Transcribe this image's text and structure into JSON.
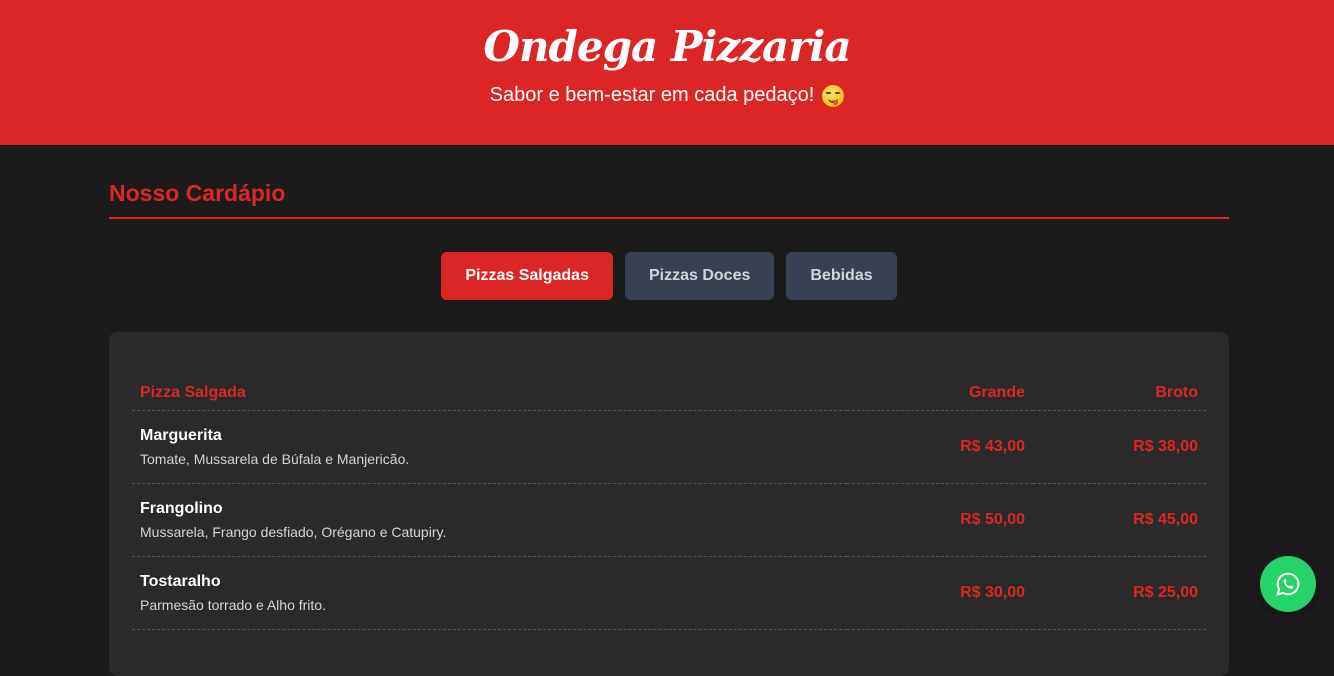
{
  "header": {
    "brand": "Ondega Pizzaria",
    "tagline": "Sabor e bem-estar em cada pedaço!",
    "tagline_icon": "savoring-face-emoji"
  },
  "menu": {
    "title": "Nosso Cardápio",
    "tabs": [
      {
        "label": "Pizzas Salgadas",
        "active": true
      },
      {
        "label": "Pizzas Doces",
        "active": false
      },
      {
        "label": "Bebidas",
        "active": false
      }
    ],
    "table": {
      "headers": {
        "name": "Pizza Salgada",
        "large": "Grande",
        "small": "Broto"
      },
      "rows": [
        {
          "name": "Marguerita",
          "desc": "Tomate, Mussarela de Búfala e Manjericão.",
          "large": "R$ 43,00",
          "small": "R$ 38,00"
        },
        {
          "name": "Frangolino",
          "desc": "Mussarela, Frango desfiado, Orégano e Catupiry.",
          "large": "R$ 50,00",
          "small": "R$ 45,00"
        },
        {
          "name": "Tostaralho",
          "desc": "Parmesão torrado e Alho frito.",
          "large": "R$ 30,00",
          "small": "R$ 25,00"
        }
      ]
    }
  },
  "floating": {
    "icon": "whatsapp-icon"
  },
  "colors": {
    "accent": "#dc2626",
    "background": "#1b1b1c",
    "card": "#2a2a2b",
    "tab_inactive": "#374151",
    "whatsapp": "#25d366"
  }
}
